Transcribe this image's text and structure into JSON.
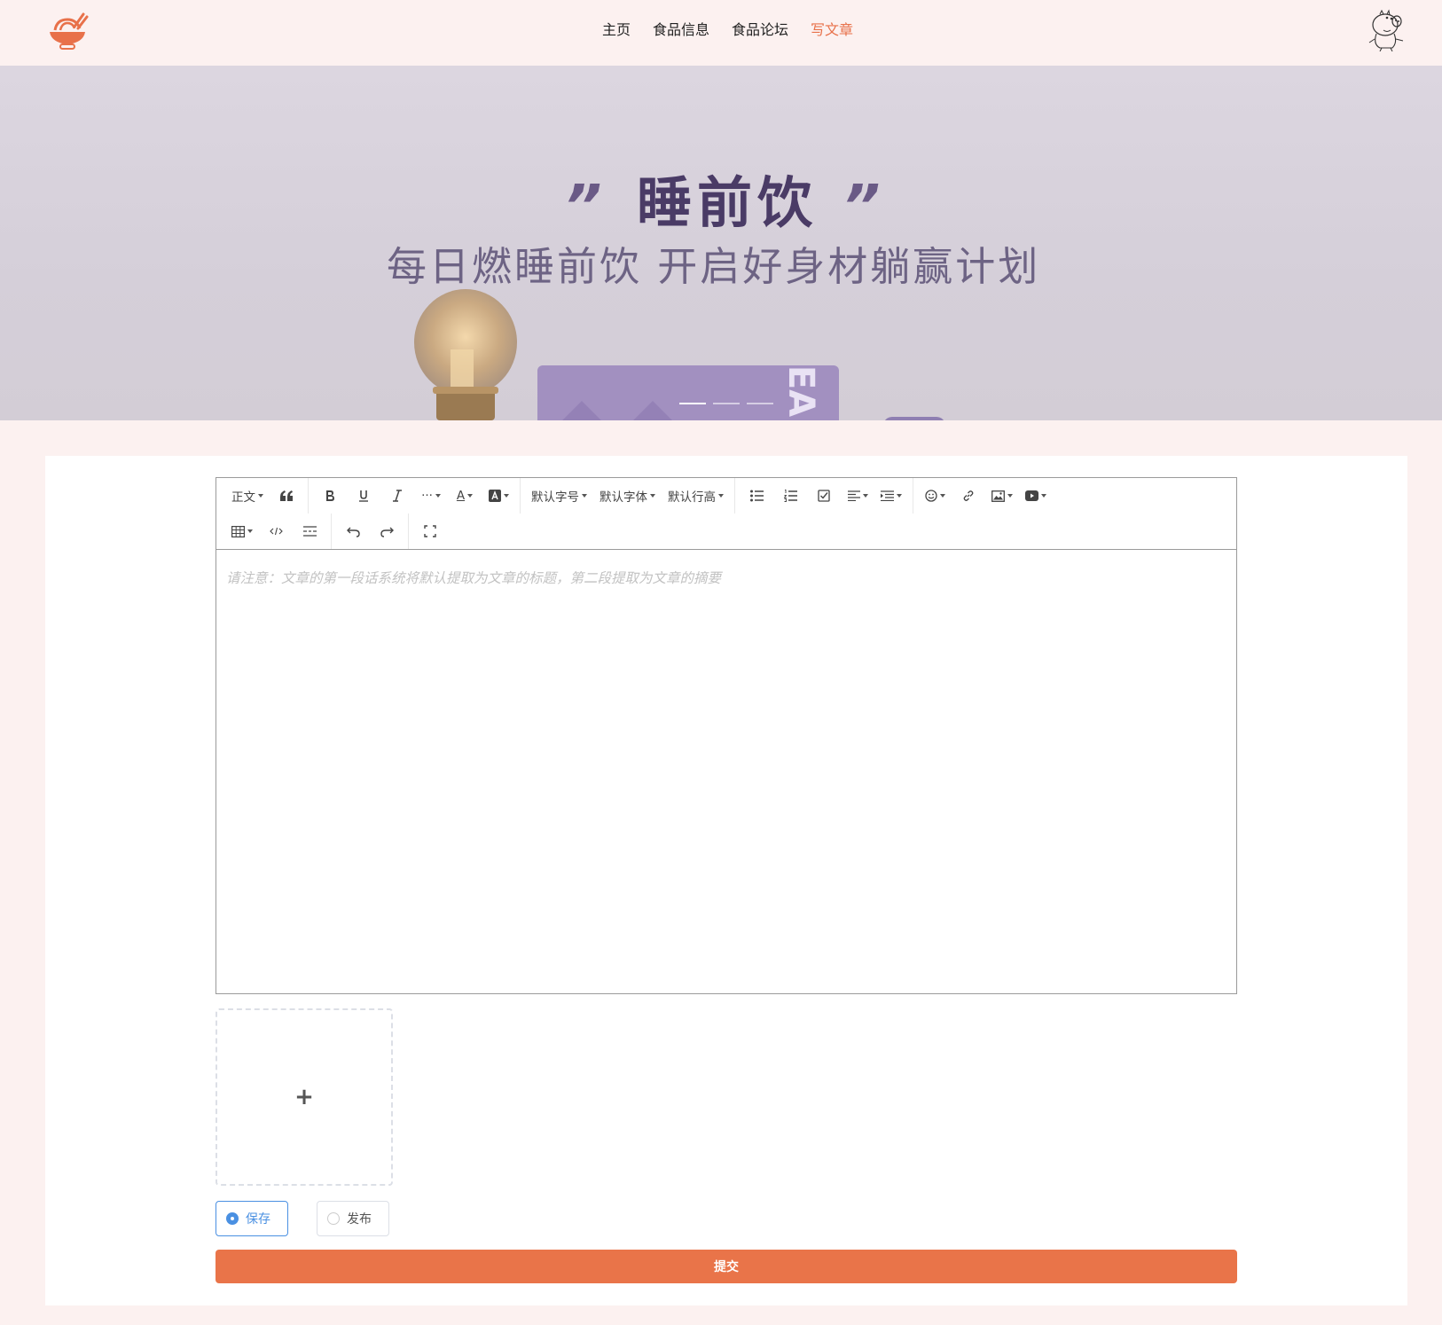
{
  "header": {
    "logo_icon": "noodle-bowl-logo-icon",
    "nav": [
      {
        "label": "主页",
        "active": false
      },
      {
        "label": "食品信息",
        "active": false
      },
      {
        "label": "食品论坛",
        "active": false
      },
      {
        "label": "写文章",
        "active": true
      }
    ],
    "avatar_icon": "pig-avatar-icon",
    "accent_color": "#e8714a"
  },
  "banner": {
    "quote_open": "”",
    "title": "睡前饮",
    "quote_close": "”",
    "subtitle": "每日燃睡前饮 开启好身材躺赢计划",
    "box_letters": "EA",
    "slides": 3,
    "active_slide": 1
  },
  "editor": {
    "toolbar_row1": {
      "heading": "正文",
      "font_size": "默认字号",
      "font_family": "默认字体",
      "line_height": "默认行高",
      "more": "···",
      "font_color": "A"
    },
    "placeholder": "请注意：文章的第一段话系统将默认提取为文章的标题，第二段提取为文章的摘要"
  },
  "upload": {
    "plus": "+"
  },
  "status_options": [
    {
      "label": "保存",
      "checked": true
    },
    {
      "label": "发布",
      "checked": false
    }
  ],
  "submit_label": "提交",
  "submit_color": "#e97449"
}
